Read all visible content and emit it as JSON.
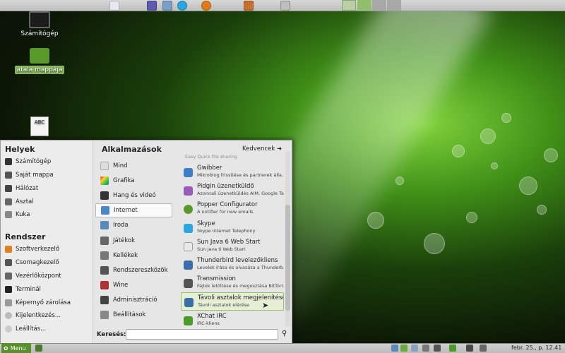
{
  "desktop": {
    "icons": [
      {
        "label": "Számítógép"
      },
      {
        "label": "atala mappája"
      },
      {
        "label": ""
      }
    ]
  },
  "menu": {
    "places_title": "Helyek",
    "places": [
      "Számítógép",
      "Saját mappa",
      "Hálózat",
      "Asztal",
      "Kuka"
    ],
    "system_title": "Rendszer",
    "system": [
      "Szoftverkezelő",
      "Csomagkezelő",
      "Vezérlőközpont",
      "Terminál",
      "Képernyő zárolása",
      "Kijelentkezés...",
      "Leállítás..."
    ],
    "apps_title": "Alkalmazások",
    "favorites_label": "Kedvencek",
    "categories": [
      "Mind",
      "Grafika",
      "Hang és videó",
      "Internet",
      "Iroda",
      "Játékok",
      "Kellékek",
      "Rendszereszközök",
      "Wine",
      "Adminisztráció",
      "Beállítások"
    ],
    "active_category": "Internet",
    "apps": [
      {
        "name": "Gwibber",
        "desc": "Mikroblog frissítése és partnerek álla..."
      },
      {
        "name": "Pidgin üzenetküldő",
        "desc": "Azonnali üzenetküldés AIM, Google Ta..."
      },
      {
        "name": "Popper Configurator",
        "desc": "A notifier for new emails"
      },
      {
        "name": "Skype",
        "desc": "Skype Internet Telephony"
      },
      {
        "name": "Sun Java 6 Web Start",
        "desc": "Sun Java 6 Web Start"
      },
      {
        "name": "Thunderbird levelezőkliens",
        "desc": "Levelek írása és olvasása a Thunderb..."
      },
      {
        "name": "Transmission",
        "desc": "Fájlok letöltése és megosztása BitTorr..."
      },
      {
        "name": "Távoli asztalok megjelenítése",
        "desc": "Távoli asztalok elérése"
      },
      {
        "name": "XChat IRC",
        "desc": "IRC-kliens"
      }
    ],
    "partial_top_desc": "Easy Quick file sharing",
    "search_label": "Keresés:",
    "search_value": ""
  },
  "taskbar": {
    "menu_label": "Menu",
    "clock": "febr. 25., p. 12.41"
  },
  "colors": {
    "accent": "#5b8e2e",
    "selected_app_bg": "#e4efd6"
  }
}
